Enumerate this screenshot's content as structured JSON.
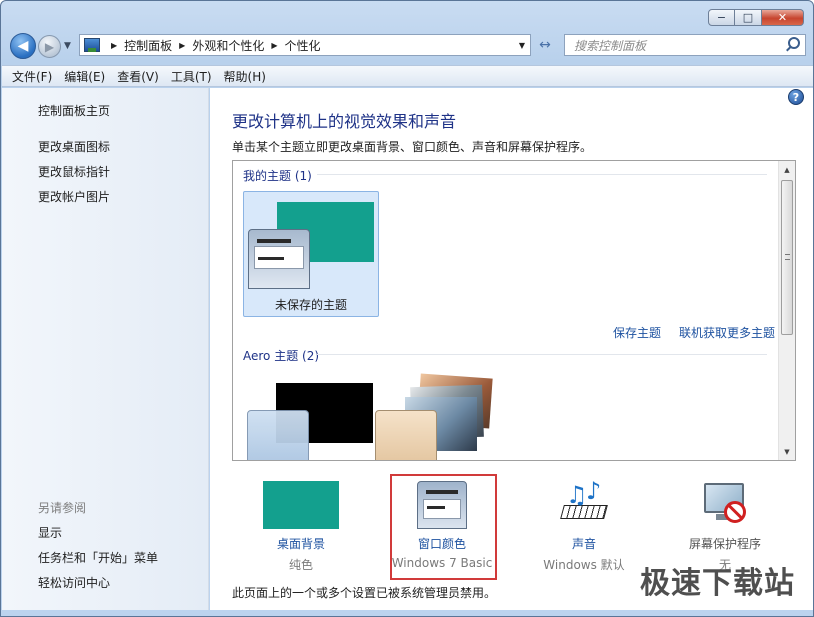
{
  "window": {
    "caption": {
      "minimize": "−",
      "maximize": "□",
      "close": "✕"
    }
  },
  "nav": {
    "back_glyph": "◀",
    "forward_glyph": "▶",
    "breadcrumbs": [
      "控制面板",
      "外观和个性化",
      "个性化"
    ],
    "breadcrumb_sep": "▶",
    "dropdown_glyph": "▼",
    "refresh_glyph": "↔"
  },
  "search": {
    "placeholder": "搜索控制面板"
  },
  "menubar": {
    "items": [
      "文件(F)",
      "编辑(E)",
      "查看(V)",
      "工具(T)",
      "帮助(H)"
    ]
  },
  "sidebar": {
    "top_links": [
      "控制面板主页",
      "更改桌面图标",
      "更改鼠标指针",
      "更改帐户图片"
    ],
    "see_also_header": "另请参阅",
    "bottom_links": [
      "显示",
      "任务栏和「开始」菜单",
      "轻松访问中心"
    ]
  },
  "main": {
    "help_glyph": "?",
    "title": "更改计算机上的视觉效果和声音",
    "subtitle": "单击某个主题立即更改桌面背景、窗口颜色、声音和屏幕保护程序。",
    "my_themes_label": "我的主题 (1)",
    "unsaved_theme_name": "未保存的主题",
    "save_theme": "保存主题",
    "get_more_themes": "联机获取更多主题",
    "aero_themes_label": "Aero 主题 (2)",
    "accent_color": "#13a08e",
    "options": [
      {
        "label": "桌面背景",
        "value": "纯色"
      },
      {
        "label": "窗口颜色",
        "value": "Windows 7 Basic"
      },
      {
        "label": "声音",
        "value": "Windows 默认"
      },
      {
        "label": "屏幕保护程序",
        "value": "无"
      }
    ],
    "footer_note": "此页面上的一个或多个设置已被系统管理员禁用。"
  },
  "watermark": "极速下载站"
}
